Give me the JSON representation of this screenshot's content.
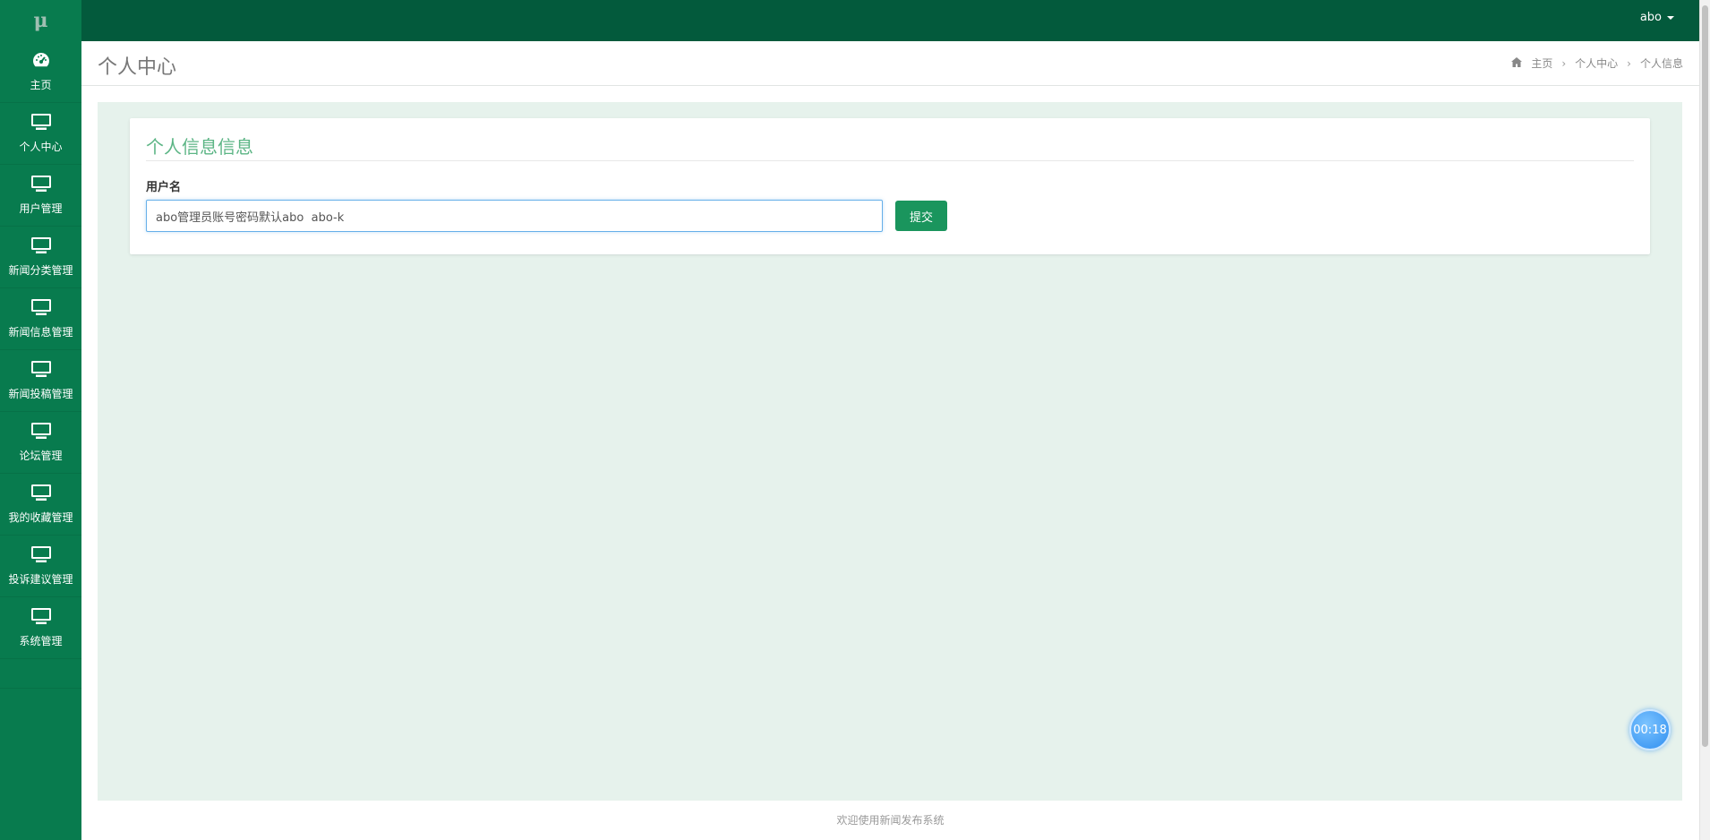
{
  "brand": {
    "logo_text": "μ"
  },
  "header": {
    "user_name": "abo"
  },
  "sidebar": {
    "items": [
      {
        "label": "主页",
        "icon": "dashboard-icon"
      },
      {
        "label": "个人中心",
        "icon": "monitor-icon"
      },
      {
        "label": "用户管理",
        "icon": "monitor-icon"
      },
      {
        "label": "新闻分类管理",
        "icon": "monitor-icon"
      },
      {
        "label": "新闻信息管理",
        "icon": "monitor-icon"
      },
      {
        "label": "新闻投稿管理",
        "icon": "monitor-icon"
      },
      {
        "label": "论坛管理",
        "icon": "monitor-icon"
      },
      {
        "label": "我的收藏管理",
        "icon": "monitor-icon"
      },
      {
        "label": "投诉建议管理",
        "icon": "monitor-icon"
      },
      {
        "label": "系统管理",
        "icon": "monitor-icon"
      }
    ]
  },
  "page": {
    "title": "个人中心",
    "breadcrumb": [
      "主页",
      "个人中心",
      "个人信息"
    ]
  },
  "form": {
    "card_title": "个人信息信息",
    "username_label": "用户名",
    "username_value": "abo管理员账号密码默认abo  abo-k",
    "submit_label": "提交"
  },
  "footer": {
    "text": "欢迎使用新闻发布系统"
  },
  "timer": {
    "text": "00:18"
  },
  "colors": {
    "topbar": "#035a3c",
    "sidebar": "#087b4e",
    "accent": "#1a955d",
    "content_bg": "#e6f2ec"
  }
}
